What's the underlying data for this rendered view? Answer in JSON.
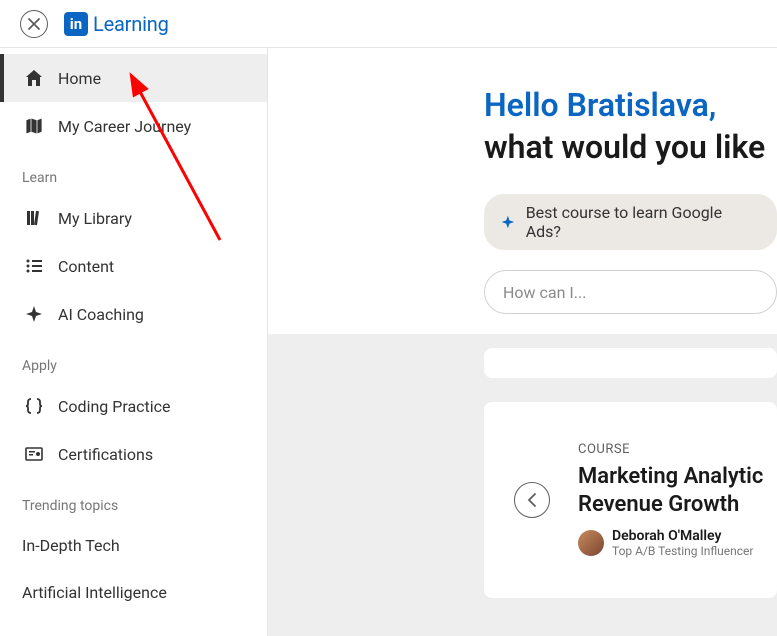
{
  "header": {
    "logo_short": "in",
    "logo_text": "Learning"
  },
  "sidebar": {
    "items": [
      {
        "label": "Home"
      },
      {
        "label": "My Career Journey"
      }
    ],
    "sections": [
      {
        "label": "Learn",
        "items": [
          {
            "label": "My Library"
          },
          {
            "label": "Content"
          },
          {
            "label": "AI Coaching"
          }
        ]
      },
      {
        "label": "Apply",
        "items": [
          {
            "label": "Coding Practice"
          },
          {
            "label": "Certifications"
          }
        ]
      }
    ],
    "trending_label": "Trending topics",
    "trending": [
      {
        "label": "In-Depth Tech"
      },
      {
        "label": "Artificial Intelligence"
      }
    ]
  },
  "main": {
    "greeting": "Hello Bratislava,",
    "prompt": "what would you like",
    "chip": "Best course to learn Google Ads?",
    "search_placeholder": "How can I...",
    "course": {
      "type_label": "COURSE",
      "title_line1": "Marketing Analytic",
      "title_line2": "Revenue Growth",
      "author_name": "Deborah O'Malley",
      "author_sub": "Top A/B Testing Influencer"
    }
  }
}
